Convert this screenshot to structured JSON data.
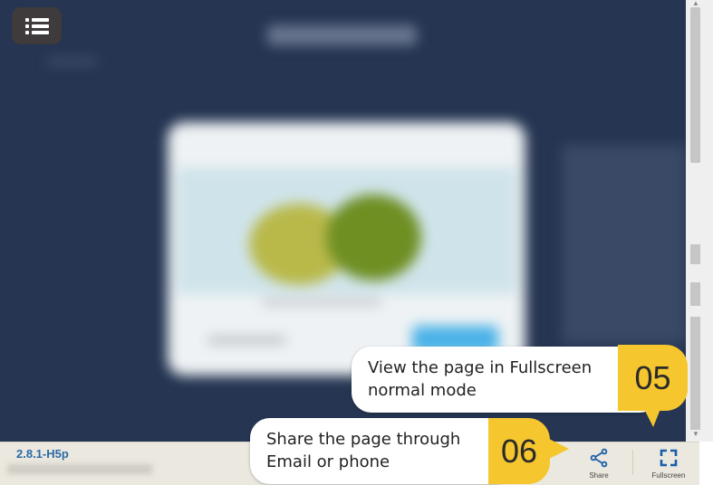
{
  "footer": {
    "version": "2.8.1-H5p",
    "share_label": "Share",
    "fullscreen_label": "Fullscreen"
  },
  "tooltips": [
    {
      "text_line1": "View the page in Fullscreen",
      "text_line2": "normal mode",
      "badge": "05"
    },
    {
      "text_line1": "Share the page through",
      "text_line2": "Email or phone",
      "badge": "06"
    }
  ],
  "icons": {
    "menu": "list-menu-icon",
    "share": "share-icon",
    "fullscreen": "fullscreen-icon"
  },
  "colors": {
    "stage_bg": "#253552",
    "badge": "#f5c62e",
    "accent": "#1a5ea8",
    "version_text": "#2b6aa8"
  }
}
